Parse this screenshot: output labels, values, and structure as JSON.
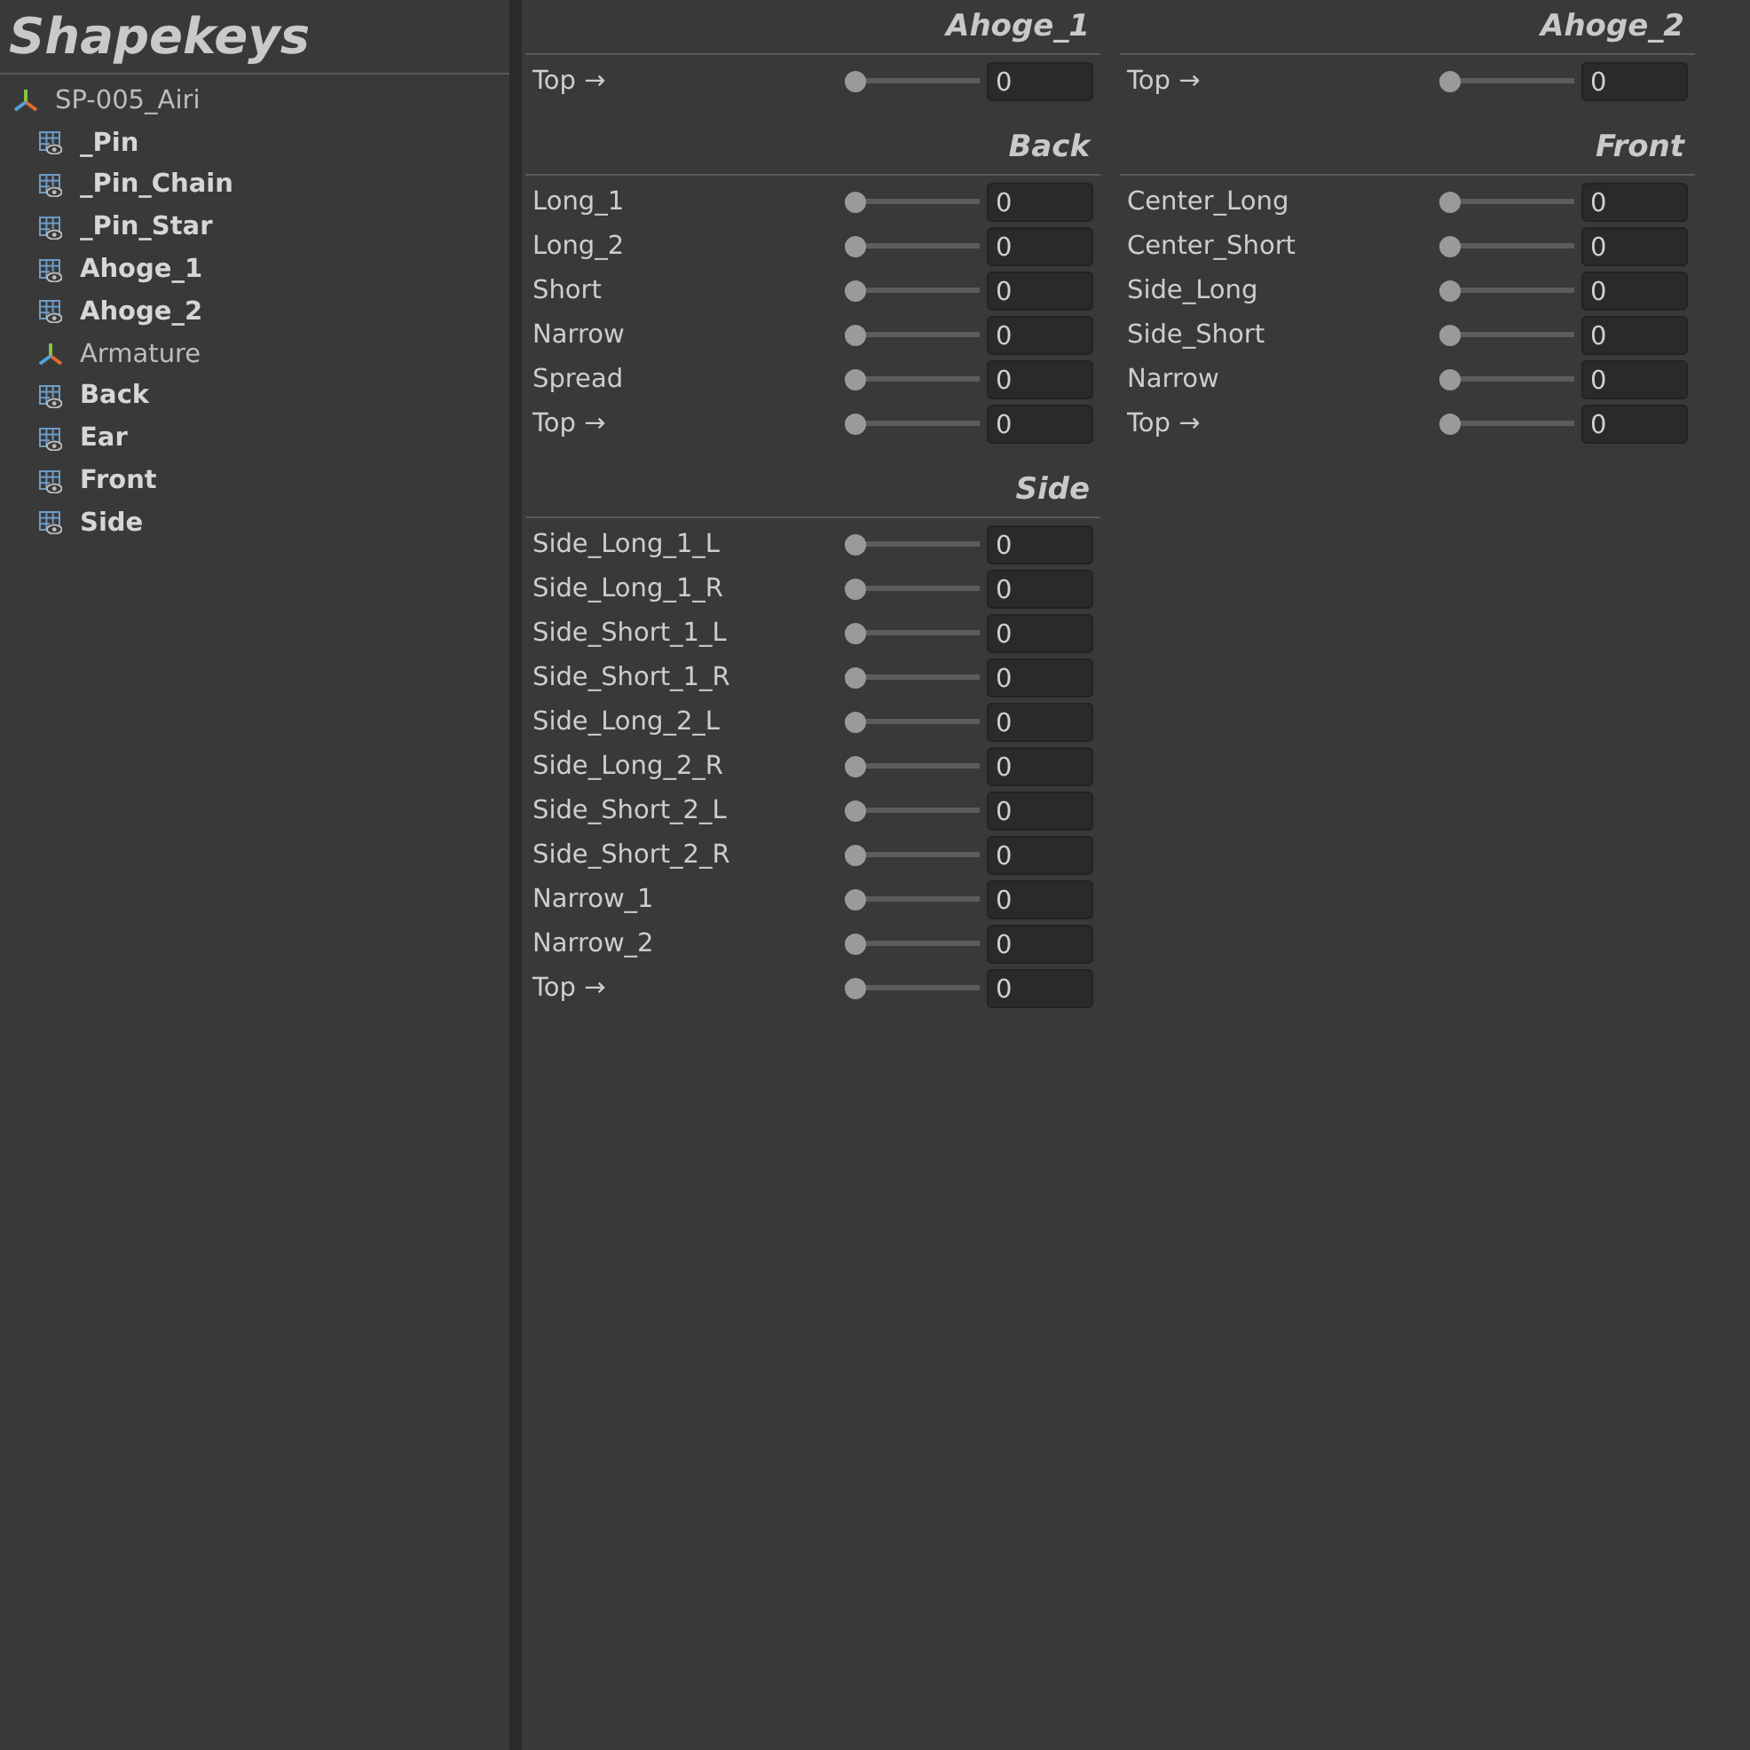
{
  "title": "Shapekeys",
  "outliner": {
    "items": [
      {
        "label": "SP-005_Airi",
        "kind": "armature",
        "children": [
          {
            "label": "_Pin",
            "kind": "mesh"
          },
          {
            "label": "_Pin_Chain",
            "kind": "mesh"
          },
          {
            "label": "_Pin_Star",
            "kind": "mesh"
          },
          {
            "label": "Ahoge_1",
            "kind": "mesh"
          },
          {
            "label": "Ahoge_2",
            "kind": "mesh"
          },
          {
            "label": "Armature",
            "kind": "armature"
          },
          {
            "label": "Back",
            "kind": "mesh"
          },
          {
            "label": "Ear",
            "kind": "mesh"
          },
          {
            "label": "Front",
            "kind": "mesh"
          },
          {
            "label": "Side",
            "kind": "mesh"
          }
        ]
      }
    ]
  },
  "sections": [
    {
      "title": "Ahoge_1",
      "sliders": [
        {
          "label": "Top →",
          "level": 0,
          "value": "0"
        }
      ]
    },
    {
      "title": "Ahoge_2",
      "sliders": [
        {
          "label": "Top →",
          "level": 0,
          "value": "0"
        }
      ]
    },
    {
      "title": "Back",
      "sliders": [
        {
          "label": "Long_1",
          "level": 0,
          "value": "0"
        },
        {
          "label": "Long_2",
          "level": 0,
          "value": "0"
        },
        {
          "label": "Short",
          "level": 0,
          "value": "0"
        },
        {
          "label": "Narrow",
          "level": 0,
          "value": "0"
        },
        {
          "label": "Spread",
          "level": 0,
          "value": "0"
        },
        {
          "label": "Top →",
          "level": 0,
          "value": "0"
        }
      ]
    },
    {
      "title": "Front",
      "sliders": [
        {
          "label": "Center_Long",
          "level": 0,
          "value": "0"
        },
        {
          "label": "Center_Short",
          "level": 0,
          "value": "0"
        },
        {
          "label": "Side_Long",
          "level": 0,
          "value": "0"
        },
        {
          "label": "Side_Short",
          "level": 0,
          "value": "0"
        },
        {
          "label": "Narrow",
          "level": 0,
          "value": "0"
        },
        {
          "label": "Top →",
          "level": 0,
          "value": "0"
        }
      ]
    },
    {
      "title": "Side",
      "sliders": [
        {
          "label": "Side_Long_1_L",
          "level": 0,
          "value": "0"
        },
        {
          "label": "Side_Long_1_R",
          "level": 0,
          "value": "0"
        },
        {
          "label": "Side_Short_1_L",
          "level": 0,
          "value": "0"
        },
        {
          "label": "Side_Short_1_R",
          "level": 0,
          "value": "0"
        },
        {
          "label": "Side_Long_2_L",
          "level": 0,
          "value": "0"
        },
        {
          "label": "Side_Long_2_R",
          "level": 0,
          "value": "0"
        },
        {
          "label": "Side_Short_2_L",
          "level": 0,
          "value": "0"
        },
        {
          "label": "Side_Short_2_R",
          "level": 0,
          "value": "0"
        },
        {
          "label": "Narrow_1",
          "level": 0,
          "value": "0"
        },
        {
          "label": "Narrow_2",
          "level": 0,
          "value": "0"
        },
        {
          "label": "Top →",
          "level": 0,
          "value": "0"
        }
      ]
    }
  ]
}
